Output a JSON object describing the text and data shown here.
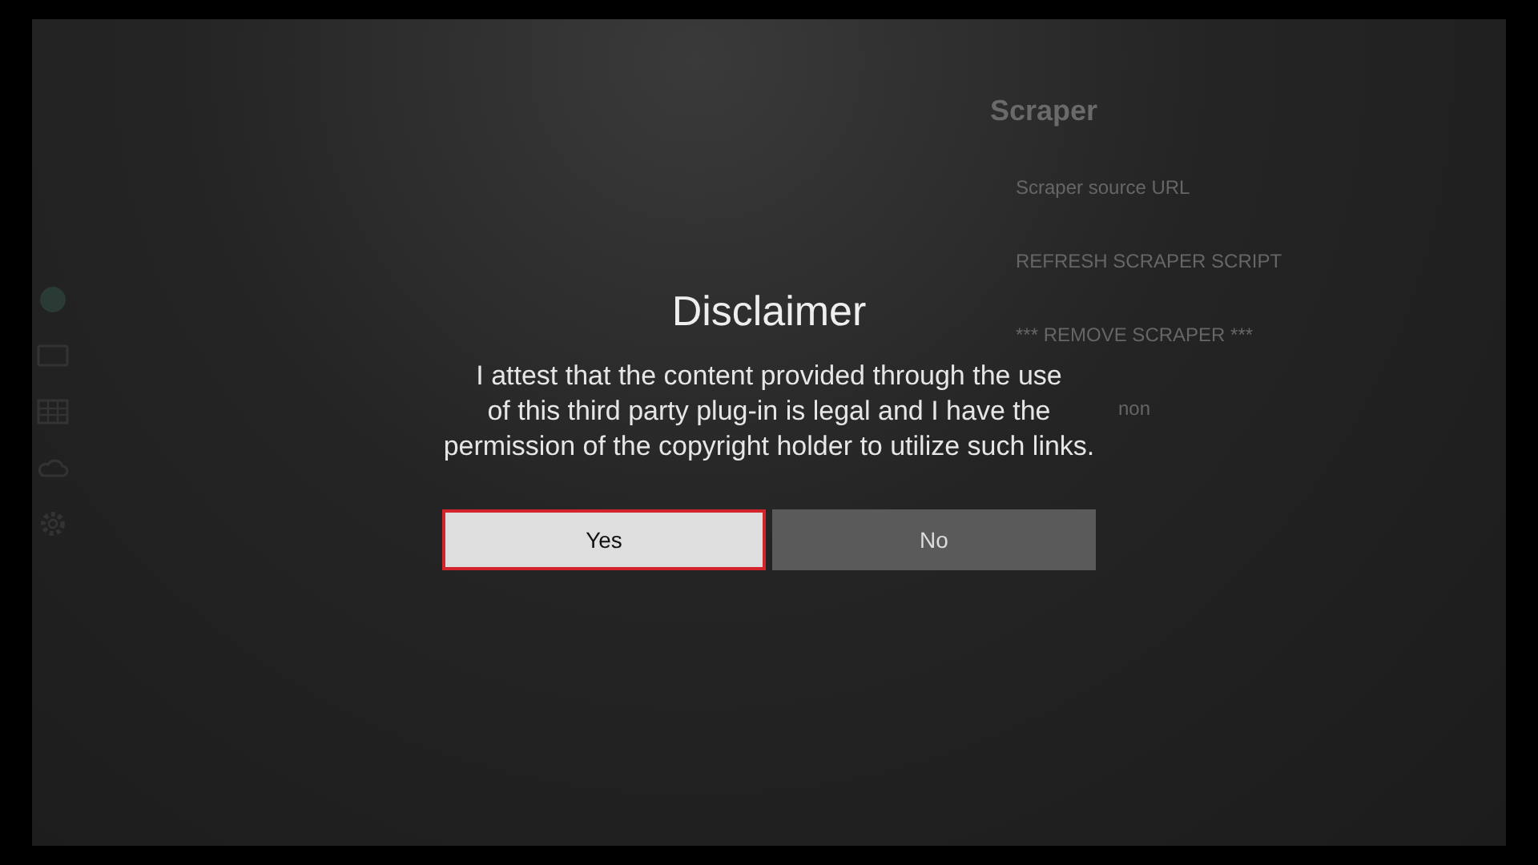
{
  "sidebar": {
    "icons": [
      {
        "kind": "circle"
      },
      {
        "kind": "tv"
      },
      {
        "kind": "grid"
      },
      {
        "kind": "cloud"
      },
      {
        "kind": "gear"
      }
    ]
  },
  "settings_panel": {
    "title": "Scraper",
    "items": [
      "Scraper source URL",
      "REFRESH SCRAPER SCRIPT",
      "*** REMOVE SCRAPER ***",
      "non"
    ]
  },
  "dialog": {
    "title": "Disclaimer",
    "message_lines": [
      "I attest that the content provided through the use",
      "of this third party plug-in is legal and I have the",
      "permission of the copyright holder to utilize such links."
    ],
    "buttons": [
      {
        "label": "Yes",
        "selected": true
      },
      {
        "label": "No",
        "selected": false
      }
    ]
  }
}
